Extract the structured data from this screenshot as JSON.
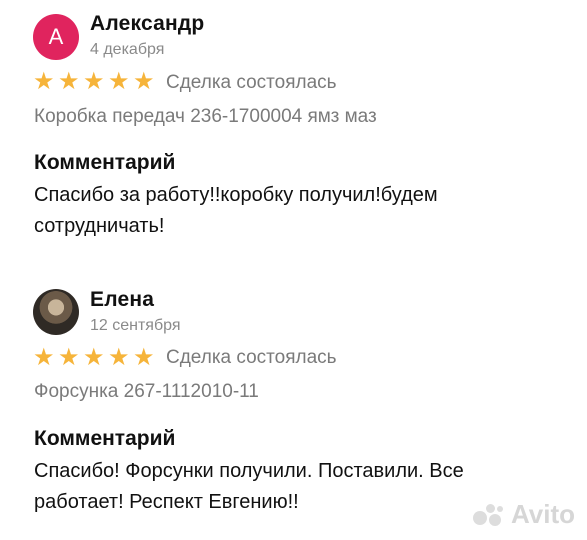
{
  "reviews": [
    {
      "avatar_letter": "А",
      "avatar_color": "#e0245e",
      "name": "Александр",
      "date": "4 декабря",
      "rating": 5,
      "deal_status": "Сделка состоялась",
      "item": "Коробка передач 236-1700004 ямз маз",
      "comment_title": "Комментарий",
      "comment": "Спасибо за работу!!коробку получил!будем сотрудничать!"
    },
    {
      "avatar_letter": "",
      "name": "Елена",
      "date": "12 сентября",
      "rating": 5,
      "deal_status": "Сделка состоялась",
      "item": "Форсунка 267-1112010-11",
      "comment_title": "Комментарий",
      "comment": "Спасибо! Форсунки получили. Поставили. Все работает! Респект Евгению!!"
    }
  ],
  "watermark": "Avito",
  "star_color": "#f6b43a"
}
